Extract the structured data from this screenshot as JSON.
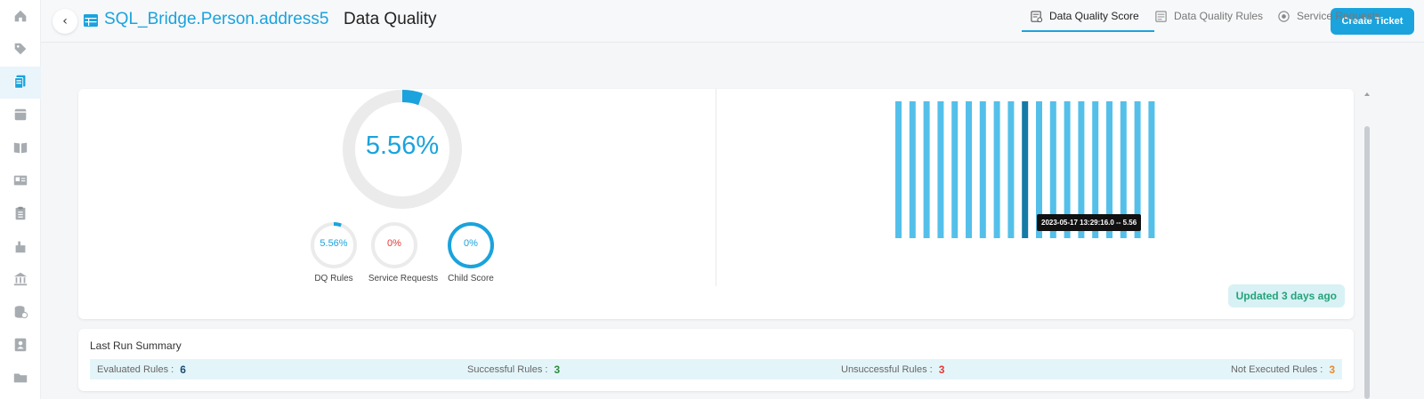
{
  "header": {
    "entity_name": "SQL_Bridge.Person.address5",
    "title_suffix": "Data Quality",
    "create_ticket_label": "Create Ticket"
  },
  "tabs": [
    {
      "label": "Data Quality Score",
      "icon": "score-icon",
      "active": true
    },
    {
      "label": "Data Quality Rules",
      "icon": "rules-icon",
      "active": false
    },
    {
      "label": "Service Requests",
      "icon": "service-requests-icon",
      "active": false
    }
  ],
  "sidebar": {
    "icons": [
      "home-icon",
      "tag-icon",
      "data-quality-icon",
      "database-icon",
      "book-icon",
      "report-icon",
      "clipboard-icon",
      "hand-icon",
      "institution-icon",
      "db-check-icon",
      "contact-icon",
      "folder-icon"
    ],
    "active_index": 2
  },
  "score": {
    "overall": "5.56%",
    "overall_fraction": 0.0556,
    "dq_rules": {
      "value": "5.56%",
      "fraction": 0.0556,
      "label": "DQ Rules",
      "color": "#1aa3dd"
    },
    "service_requests": {
      "value": "0%",
      "fraction": 0,
      "label": "Service Requests",
      "color": "#e53935"
    },
    "child_score": {
      "value": "0%",
      "fraction": 1,
      "label": "Child Score",
      "color": "#1aa3dd"
    }
  },
  "chart_data": {
    "type": "bar",
    "bar_count": 19,
    "highlighted_index": 9,
    "values": [
      5.56,
      5.56,
      5.56,
      5.56,
      5.56,
      5.56,
      5.56,
      5.56,
      5.56,
      5.56,
      5.56,
      5.56,
      5.56,
      5.56,
      5.56,
      5.56,
      5.56,
      5.56,
      5.56
    ],
    "color": "#54c0ea",
    "highlight_color": "#157aa6",
    "tooltip": "2023-05-17 13:29:16.0 -- 5.56"
  },
  "updated_label": "Updated 3 days ago",
  "summary": {
    "title": "Last Run Summary",
    "evaluated": {
      "label": "Evaluated Rules :",
      "value": "6",
      "color": "#1a4e73"
    },
    "successful": {
      "label": "Successful Rules :",
      "value": "3",
      "color": "#2e8b3e"
    },
    "unsuccessful": {
      "label": "Unsuccessful Rules :",
      "value": "3",
      "color": "#e53935"
    },
    "not_executed": {
      "label": "Not Executed Rules :",
      "value": "3",
      "color": "#f08a24"
    }
  }
}
